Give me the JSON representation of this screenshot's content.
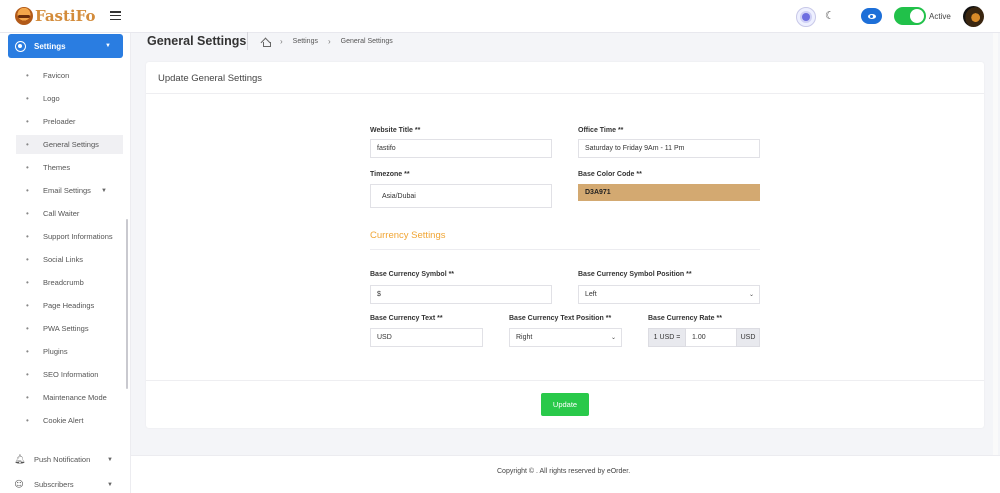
{
  "brand": {
    "name": "FastiFo"
  },
  "topbar": {
    "status_label": "Active"
  },
  "sidebar": {
    "active": {
      "label": "Settings"
    },
    "items": [
      {
        "label": "Favicon"
      },
      {
        "label": "Logo"
      },
      {
        "label": "Preloader"
      },
      {
        "label": "General Settings"
      },
      {
        "label": "Themes"
      },
      {
        "label": "Email Settings"
      },
      {
        "label": "Call Waiter"
      },
      {
        "label": "Support Informations"
      },
      {
        "label": "Social Links"
      },
      {
        "label": "Breadcrumb"
      },
      {
        "label": "Page Headings"
      },
      {
        "label": "PWA Settings"
      },
      {
        "label": "Plugins"
      },
      {
        "label": "SEO Information"
      },
      {
        "label": "Maintenance Mode"
      },
      {
        "label": "Cookie Alert"
      }
    ],
    "bottom": [
      {
        "label": "Push Notification",
        "icon": "bell-icon"
      },
      {
        "label": "Subscribers",
        "icon": "users-icon"
      }
    ]
  },
  "page": {
    "title": "General Settings",
    "breadcrumb": [
      "Settings",
      "General Settings"
    ]
  },
  "card": {
    "title": "Update General Settings",
    "fields": {
      "website_title": {
        "label": "Website Title **",
        "value": "fastifo"
      },
      "office_time": {
        "label": "Office Time **",
        "value": "Saturday to Friday  9Am - 11 Pm"
      },
      "timezone": {
        "label": "Timezone **",
        "value": "Asia/Dubai"
      },
      "base_color": {
        "label": "Base Color Code **",
        "value": "D3A971",
        "color": "#d3a971"
      }
    },
    "currency": {
      "section_title": "Currency Settings",
      "symbol": {
        "label": "Base Currency Symbol **",
        "value": "$"
      },
      "symbol_position": {
        "label": "Base Currency Symbol Position **",
        "value": "Left"
      },
      "text": {
        "label": "Base Currency Text **",
        "value": "USD"
      },
      "text_position": {
        "label": "Base Currency Text Position **",
        "value": "Right"
      },
      "rate": {
        "label": "Base Currency Rate **",
        "prefix": "1 USD =",
        "value": "1.00",
        "suffix": "USD"
      }
    },
    "update_label": "Update"
  },
  "footer": {
    "text": "Copyright © . All rights reserved by eOrder."
  },
  "colors": {
    "accent": "#2a7de1",
    "success": "#29c94a",
    "section_title": "#f0a534"
  }
}
